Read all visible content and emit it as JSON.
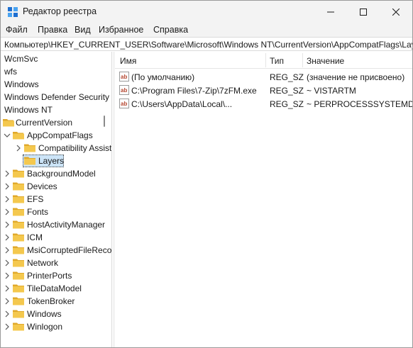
{
  "window": {
    "title": "Редактор реестра"
  },
  "menu": [
    "Файл",
    "Правка",
    "Вид",
    "Избранное",
    "Справка"
  ],
  "address": "Компьютер\\HKEY_CURRENT_USER\\Software\\Microsoft\\Windows NT\\CurrentVersion\\AppCompatFlags\\Layers",
  "tree": {
    "top_items": [
      "WcmSvc",
      "wfs",
      "Windows",
      "Windows Defender Security",
      "Windows NT"
    ],
    "current_version": "CurrentVersion",
    "appcompat": "AppCompatFlags",
    "compatibility": "Compatibility Assistant",
    "layers": "Layers",
    "children": [
      "BackgroundModel",
      "Devices",
      "EFS",
      "Fonts",
      "HostActivityManager",
      "ICM",
      "MsiCorruptedFileRecovery",
      "Network",
      "PrinterPorts",
      "TileDataModel",
      "TokenBroker",
      "Windows",
      "Winlogon"
    ]
  },
  "list": {
    "columns": {
      "name": "Имя",
      "type": "Тип",
      "data": "Значение"
    },
    "rows": [
      {
        "name": "(По умолчанию)",
        "type": "REG_SZ",
        "data": "(значение не присвоено)"
      },
      {
        "name": "C:\\Program Files\\7-Zip\\7zFM.exe",
        "type": "REG_SZ",
        "data": "~ VISTARTM"
      },
      {
        "name": "C:\\Users\\AppData\\Local\\...",
        "type": "REG_SZ",
        "data": "~ PERPROCESSSYSTEMDPIFORCEON"
      }
    ]
  },
  "colors": {
    "folder": "#f4c84e",
    "folder_dark": "#e0a92b",
    "selection": "#cce4f7",
    "value_icon": "#b5462f"
  }
}
